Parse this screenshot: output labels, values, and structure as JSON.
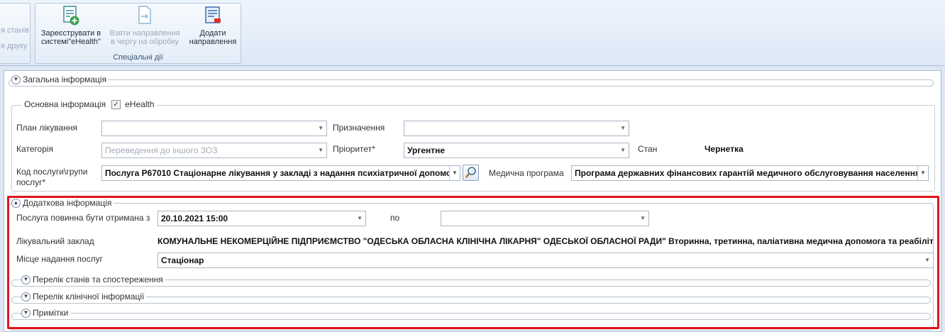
{
  "ribbon": {
    "left_partial": {
      "line1": "я станів",
      "line2": "я друку"
    },
    "buttons": [
      {
        "line1": "Зареєструвати в",
        "line2": "системі\"eHealth\"",
        "icon": "register-ehealth-icon"
      },
      {
        "line1": "Взяти направлення",
        "line2": "в чергу на обробку",
        "icon": "queue-referral-icon"
      },
      {
        "line1": "Додати",
        "line2": "направлення",
        "icon": "add-referral-icon"
      }
    ],
    "group_label": "Спеціальні дії"
  },
  "general": {
    "title": "Загальна інформація"
  },
  "basic": {
    "title": "Основна інформація",
    "ehealth_label": "eHealth",
    "ehealth_checked": true,
    "plan_label": "План лікування",
    "plan_value": "",
    "assign_label": "Призначення",
    "assign_value": "",
    "category_label": "Категорія",
    "category_value": "Переведення до іншого ЗОЗ",
    "priority_label": "Пріоритет*",
    "priority_value": "Ургентне",
    "state_label": "Стан",
    "state_value": "Чернетка",
    "service_label_1": "Код послуги\\групи",
    "service_label_2": "послуг*",
    "service_value": "Послуга P67010 Стаціонарне лікування у закладі з надання психіатричної допомо",
    "program_label": "Медична програма",
    "program_value": "Програма державних фінансових гарантій медичного обслуговування населення"
  },
  "additional": {
    "title": "Додаткова інформація",
    "from_label": "Послуга повинна бути отримана з",
    "from_value": "20.10.2021 15:00",
    "to_label": "по",
    "to_value": "",
    "facility_label": "Лікувальний заклад",
    "facility_value": "КОМУНАЛЬНЕ НЕКОМЕРЦІЙНЕ ПІДПРИЄМСТВО \"ОДЕСЬКА ОБЛАСНА КЛІНІЧНА ЛІКАРНЯ\" ОДЕСЬКОЇ ОБЛАСНОЇ РАДИ\" Вторинна, третинна, паліативна медична допомога та реабіліт",
    "place_label": "Місце надання послуг",
    "place_value": "Стаціонар",
    "sub_sections": [
      "Перелік станів та спостереження",
      "Перелік клінічної інформації",
      "Примітки"
    ]
  },
  "colors": {
    "highlight": "#e0131b",
    "ribbon_bg": "#dde8f6"
  }
}
